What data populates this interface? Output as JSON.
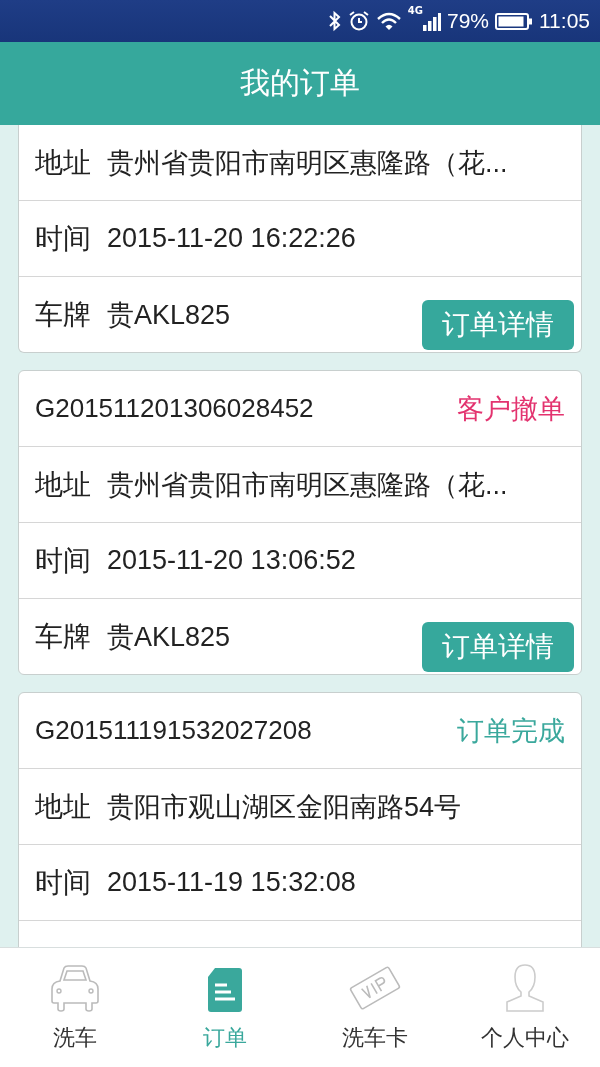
{
  "status_bar": {
    "network": "4G",
    "battery": "79%",
    "time": "11:05"
  },
  "header": {
    "title": "我的订单"
  },
  "orders": [
    {
      "address_label": "地址",
      "address": "贵州省贵阳市南明区惠隆路（花...",
      "time_label": "时间",
      "time": "2015-11-20 16:22:26",
      "plate_label": "车牌",
      "plate": "贵AKL825",
      "button": "订单详情"
    },
    {
      "number": "G201511201306028452",
      "status": "客户撤单",
      "kind": "cancelled",
      "address_label": "地址",
      "address": "贵州省贵阳市南明区惠隆路（花...",
      "time_label": "时间",
      "time": "2015-11-20 13:06:52",
      "plate_label": "车牌",
      "plate": "贵AKL825",
      "button": "订单详情"
    },
    {
      "number": "G201511191532027208",
      "status": "订单完成",
      "kind": "completed",
      "address_label": "地址",
      "address": "贵阳市观山湖区金阳南路54号",
      "time_label": "时间",
      "time": "2015-11-19 15:32:08"
    }
  ],
  "nav": [
    {
      "label": "洗车",
      "kind": "car",
      "selected": false
    },
    {
      "label": "订单",
      "kind": "document",
      "selected": true
    },
    {
      "label": "洗车卡",
      "kind": "vip",
      "selected": false
    },
    {
      "label": "个人中心",
      "kind": "person",
      "selected": false
    }
  ]
}
